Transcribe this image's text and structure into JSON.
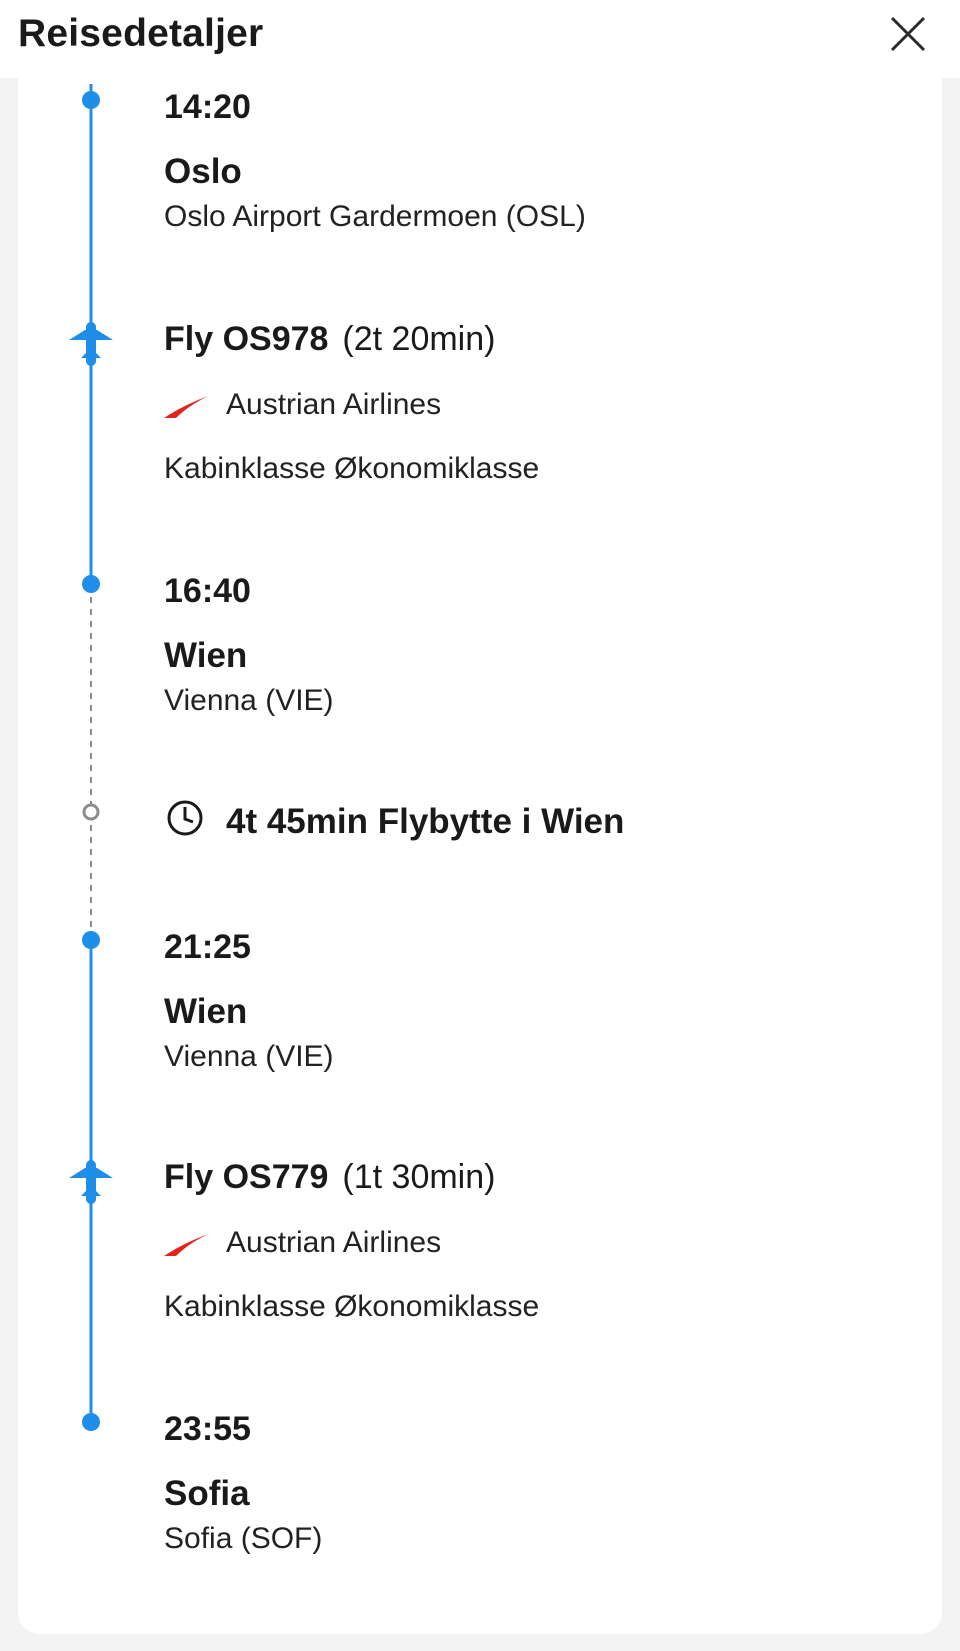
{
  "header": {
    "title": "Reisedetaljer"
  },
  "itinerary": {
    "stop1": {
      "time": "14:20",
      "city": "Oslo",
      "airport": "Oslo Airport Gardermoen (OSL)"
    },
    "flight1": {
      "label": "Fly OS978",
      "duration": "(2t 20min)",
      "airline": "Austrian Airlines",
      "cabin": "Kabinklasse Økonomiklasse"
    },
    "stop2": {
      "time": "16:40",
      "city": "Wien",
      "airport": "Vienna (VIE)"
    },
    "layover": {
      "text": "4t 45min Flybytte i Wien"
    },
    "stop3": {
      "time": "21:25",
      "city": "Wien",
      "airport": "Vienna (VIE)"
    },
    "flight2": {
      "label": "Fly OS779",
      "duration": "(1t 30min)",
      "airline": "Austrian Airlines",
      "cabin": "Kabinklasse Økonomiklasse"
    },
    "stop4": {
      "time": "23:55",
      "city": "Sofia",
      "airport": "Sofia (SOF)"
    }
  },
  "colors": {
    "accent": "#1e8ee8",
    "airline_logo": "#e3241b",
    "dashed": "#8c8c8c"
  },
  "icons": [
    "close-icon",
    "plane-icon",
    "airline-logo-icon",
    "clock-icon"
  ]
}
